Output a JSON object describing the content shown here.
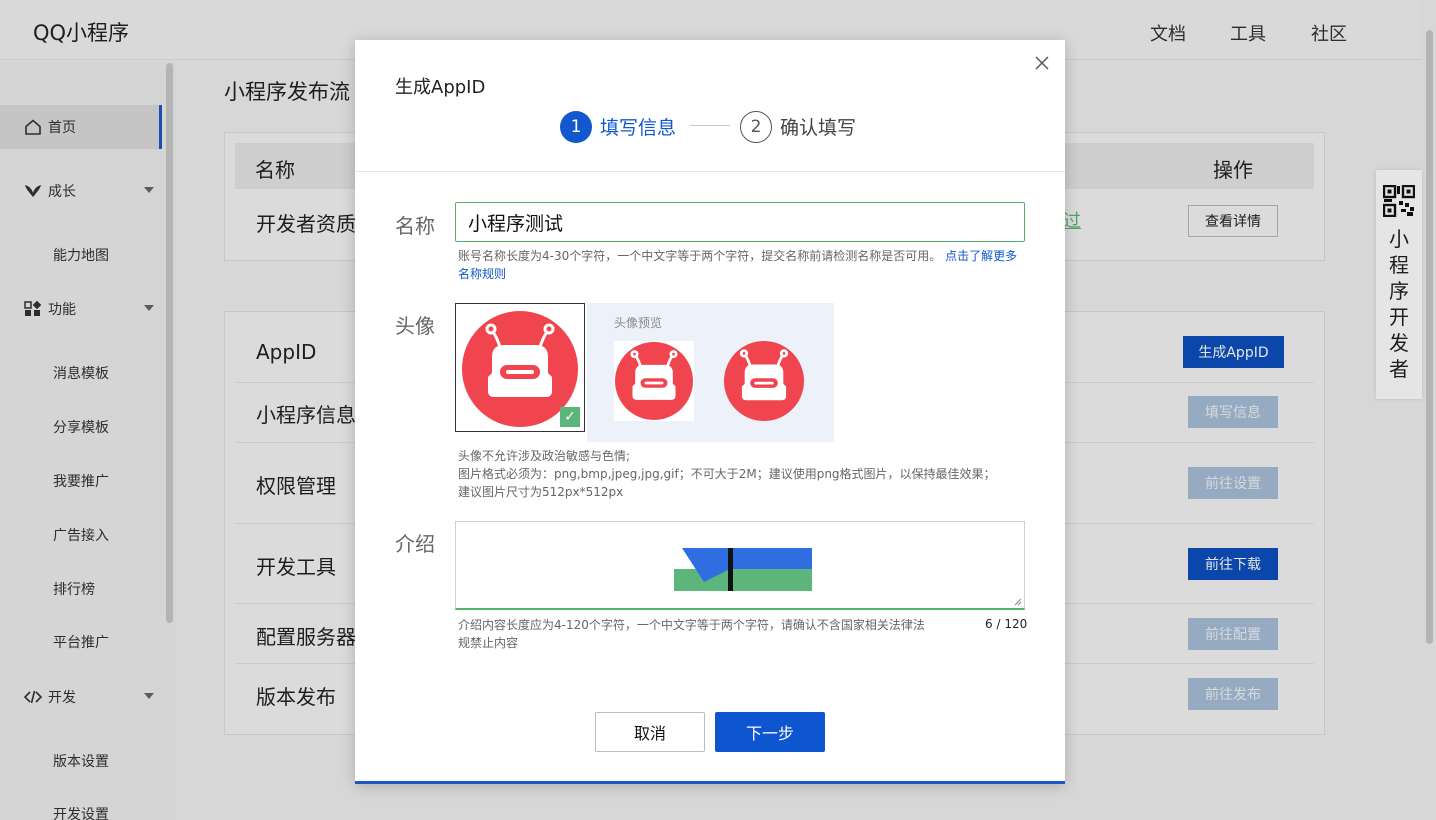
{
  "header": {
    "logo": "QQ小程序",
    "nav": [
      "文档",
      "工具",
      "社区"
    ]
  },
  "sidebar": {
    "items": [
      {
        "label": "首页",
        "icon": "home-icon",
        "active": true
      },
      {
        "label": "成长",
        "icon": "growth-icon",
        "caret": true
      },
      {
        "label": "能力地图"
      },
      {
        "label": "功能",
        "icon": "grid-icon",
        "caret": true
      },
      {
        "label": "消息模板"
      },
      {
        "label": "分享模板"
      },
      {
        "label": "我要推广"
      },
      {
        "label": "广告接入"
      },
      {
        "label": "排行榜"
      },
      {
        "label": "平台推广"
      },
      {
        "label": "开发",
        "icon": "code-icon",
        "caret": true
      },
      {
        "label": "版本设置"
      },
      {
        "label": "开发设置"
      }
    ]
  },
  "main": {
    "title": "小程序发布流",
    "table": {
      "col_name": "名称",
      "col_op": "操作",
      "row": {
        "label": "开发者资质",
        "status_fragment": "过",
        "button": "查看详情"
      }
    },
    "steps": [
      {
        "label": "AppID",
        "button": "生成AppID",
        "state": "strong"
      },
      {
        "label": "小程序信息",
        "button": "填写信息",
        "state": "faint"
      },
      {
        "label": "权限管理",
        "button": "前往设置",
        "state": "faint"
      },
      {
        "label": "开发工具",
        "button": "前往下载",
        "state": "strong"
      },
      {
        "label": "配置服务器",
        "button": "前往配置",
        "state": "faint"
      },
      {
        "label": "版本发布",
        "button": "前往发布",
        "state": "faint"
      }
    ]
  },
  "qr_panel": {
    "text": "小程序开发者"
  },
  "modal": {
    "title": "生成AppID",
    "step1": {
      "number": "1",
      "label": "填写信息"
    },
    "step2": {
      "number": "2",
      "label": "确认填写"
    },
    "name_label": "名称",
    "name_value": "小程序测试",
    "name_hint": "账号名称长度为4-30个字符，一个中文字等于两个字符，提交名称前请检测名称是否可用。",
    "name_hint_link": "点击了解更多名称规则",
    "avatar_label": "头像",
    "avatar_preview_title": "头像预览",
    "avatar_hints": [
      "头像不允许涉及政治敏感与色情;",
      "图片格式必须为：png,bmp,jpeg,jpg,gif；不可大于2M；建议使用png格式图片，以保持最佳效果；",
      "建议图片尺寸为512px*512px"
    ],
    "intro_label": "介绍",
    "intro_hint": "介绍内容长度应为4-120个字符，一个中文字等于两个字符，请确认不含国家相关法律法规禁止内容",
    "intro_count": "6",
    "intro_max": "/ 120",
    "cancel": "取消",
    "next": "下一步"
  },
  "colors": {
    "primary": "#1158cf",
    "success": "#5cb57a",
    "avatar": "#f0454f"
  }
}
